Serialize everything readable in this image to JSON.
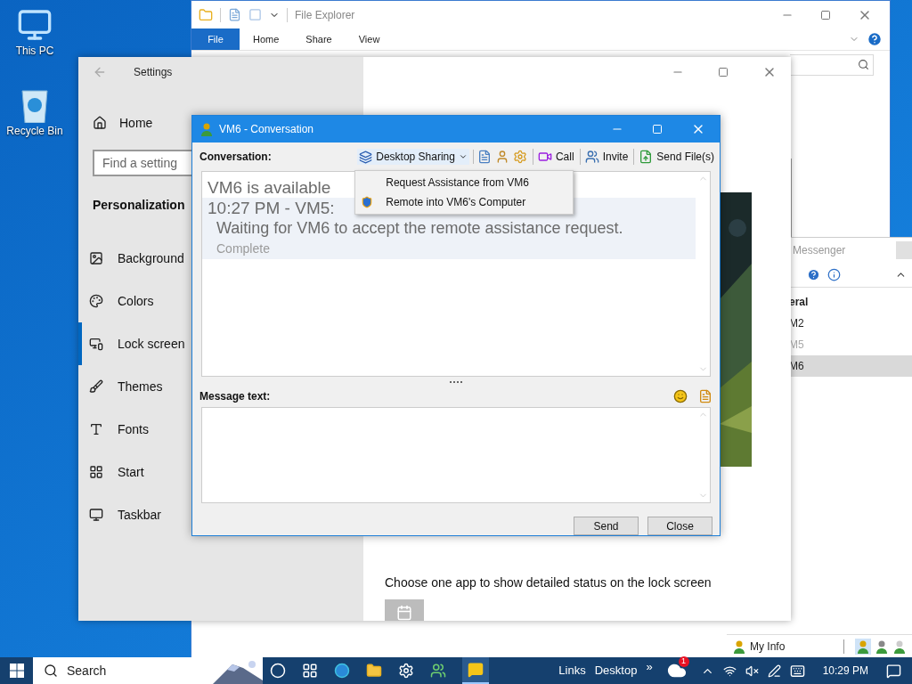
{
  "desktop_icons": [
    {
      "label": "This PC"
    },
    {
      "label": "Recycle Bin"
    }
  ],
  "file_explorer": {
    "title": "File Explorer",
    "ribbon_tabs": [
      {
        "label": "File",
        "selected": true
      },
      {
        "label": "Home",
        "selected": false
      },
      {
        "label": "Share",
        "selected": false
      },
      {
        "label": "View",
        "selected": false
      }
    ]
  },
  "settings": {
    "title": "Settings",
    "home": "Home",
    "search_placeholder": "Find a setting",
    "section": "Personalization",
    "nav": [
      {
        "label": "Background",
        "selected": false
      },
      {
        "label": "Colors",
        "selected": false
      },
      {
        "label": "Lock screen",
        "selected": true
      },
      {
        "label": "Themes",
        "selected": false
      },
      {
        "label": "Fonts",
        "selected": false
      },
      {
        "label": "Start",
        "selected": false
      },
      {
        "label": "Taskbar",
        "selected": false
      }
    ],
    "status_text": "Choose one app to show detailed status on the lock screen"
  },
  "messenger": {
    "title": "Messenger",
    "group": "eral",
    "contacts": [
      {
        "name": "M2",
        "online": true,
        "selected": false
      },
      {
        "name": "M5",
        "online": false,
        "selected": false
      },
      {
        "name": "M6",
        "online": true,
        "selected": true
      }
    ],
    "my_info": "My Info"
  },
  "conversation": {
    "title": "VM6 - Conversation",
    "label": "Conversation:",
    "toolbar": [
      {
        "kind": "dropdown",
        "label": "Desktop Sharing",
        "expanded": true
      },
      {
        "kind": "icon"
      },
      {
        "kind": "icon"
      },
      {
        "kind": "icon"
      },
      {
        "kind": "button",
        "label": "Call"
      },
      {
        "kind": "button",
        "label": "Invite"
      },
      {
        "kind": "button",
        "label": "Send File(s)"
      }
    ],
    "menu": [
      {
        "label": "Request Assistance from VM6"
      },
      {
        "label": "Remote into VM6's Computer"
      }
    ],
    "messages": [
      {
        "kind": "status",
        "text": "VM6 is available"
      },
      {
        "kind": "header",
        "text": "10:27 PM - VM5:"
      },
      {
        "kind": "body",
        "text": "Waiting for VM6 to accept the remote assistance request."
      },
      {
        "kind": "note",
        "text": "Complete"
      }
    ],
    "message_label": "Message text:",
    "buttons": [
      "Send",
      "Close"
    ]
  },
  "taskbar": {
    "search_placeholder": "Search",
    "links": "Links",
    "desktop": "Desktop",
    "more": "»",
    "cloud_badge": "1",
    "time": "10:29 PM"
  }
}
